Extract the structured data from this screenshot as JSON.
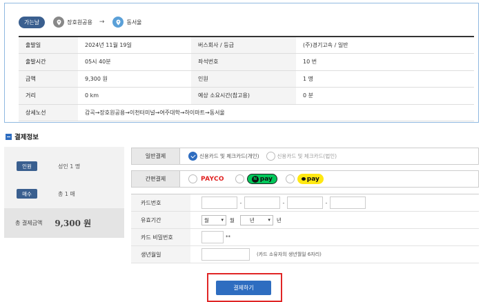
{
  "route": {
    "badge": "가는날",
    "from": "장호원공용",
    "arrow": "→",
    "to": "동서울"
  },
  "info": {
    "rows": [
      {
        "l1": "출발일",
        "v1": "2024년 11월 19일",
        "l2": "버스회사 / 등급",
        "v2": "(주)경기고속 / 일반"
      },
      {
        "l1": "출발시간",
        "v1": "05시 40분",
        "l2": "좌석번호",
        "v2": "10 번"
      },
      {
        "l1": "금액",
        "v1": "9,300 원",
        "l2": "인원",
        "v2": "1 명"
      },
      {
        "l1": "거리",
        "v1": "0 km",
        "l2": "예상 소요시간(참고용)",
        "v2": "0 분"
      }
    ],
    "route_detail_label": "상세노선",
    "route_detail": "감곡→장호원공용→이천터미널→여주대학→하이마트→동서울"
  },
  "payment": {
    "section_title": "결제정보",
    "summary": {
      "persons_badge": "인원",
      "persons_value": "성인 1 명",
      "count_badge": "매수",
      "count_value": "총 1 매",
      "total_label": "총 결제금액",
      "total_amount": "9,300 원"
    },
    "general": {
      "label": "일반결제",
      "options": [
        "신용카드 및 체크카드(개인)",
        "신용카드 및 체크카드(법인)"
      ],
      "selected_index": 0
    },
    "easy": {
      "label": "간편결제",
      "payco": "PAYCO",
      "npay": "pay",
      "npay_n": "N",
      "kpay": "pay"
    },
    "card_form": {
      "card_number_label": "카드번호",
      "dash": "-",
      "expiry_label": "유효기간",
      "month_value": "월",
      "month_unit": "월",
      "year_value": "년",
      "year_unit": "년",
      "password_label": "카드 비밀번호",
      "password_suffix": "**",
      "birth_label": "생년월일",
      "birth_hint": "(카드 소유자의 생년월일 6자리)"
    },
    "submit": "결제하기"
  }
}
